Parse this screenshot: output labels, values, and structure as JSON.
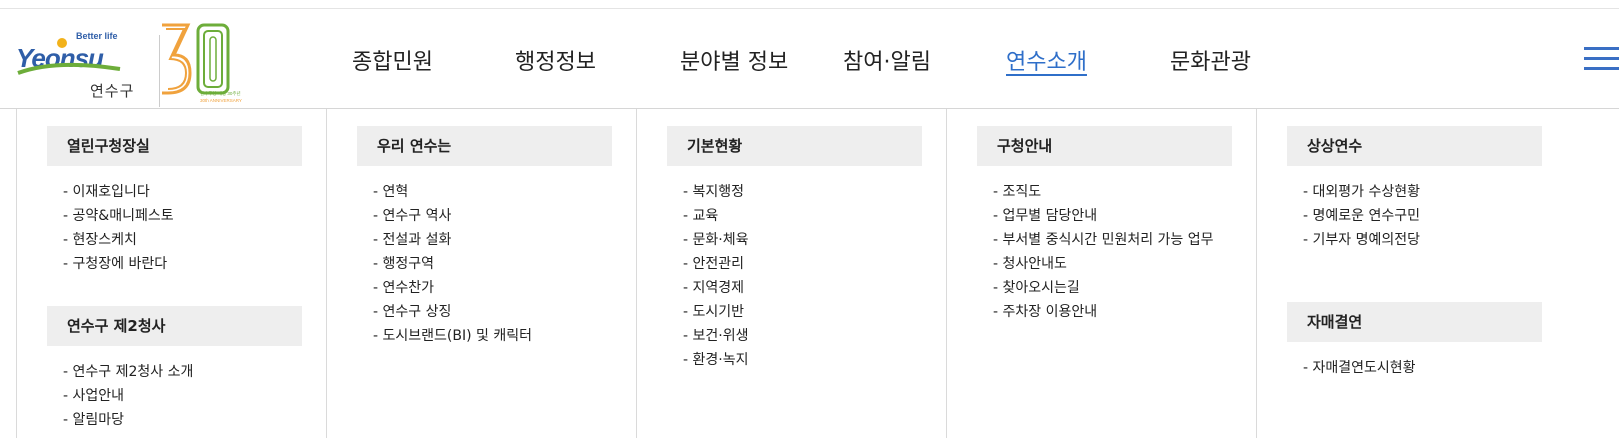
{
  "logo": {
    "tagline": "Better life",
    "wordmark": "Yeonsu",
    "district": "연수구",
    "anniversary_number": "30",
    "anniversary_small": "연수구청 개청 30주년",
    "anniversary_en": "30th ANNIVERSARY",
    "colors": {
      "green": "#6dad3a",
      "orange": "#f0a23d",
      "blue": "#2f5ea8",
      "gold": "#f2b21b"
    }
  },
  "nav": {
    "items": [
      {
        "label": "종합민원",
        "active": false
      },
      {
        "label": "행정정보",
        "active": false
      },
      {
        "label": "분야별 정보",
        "active": false
      },
      {
        "label": "참여·알림",
        "active": false
      },
      {
        "label": "연수소개",
        "active": true
      },
      {
        "label": "문화관광",
        "active": false
      }
    ],
    "menu_icon": "hamburger-menu-icon",
    "active_color": "#2f6fc9"
  },
  "mega_menu": {
    "columns": [
      {
        "sections": [
          {
            "title": "열린구청장실",
            "links": [
              "이재호입니다",
              "공약&매니페스토",
              "현장스케치",
              "구청장에 바란다"
            ]
          },
          {
            "title": "연수구 제2청사",
            "links": [
              "연수구 제2청사 소개",
              "사업안내",
              "알림마당"
            ]
          }
        ]
      },
      {
        "sections": [
          {
            "title": "우리 연수는",
            "links": [
              "연혁",
              "연수구 역사",
              "전설과 설화",
              "행정구역",
              "연수찬가",
              "연수구 상징",
              "도시브랜드(BI) 및 캐릭터"
            ]
          }
        ]
      },
      {
        "sections": [
          {
            "title": "기본현황",
            "links": [
              "복지행정",
              "교육",
              "문화·체육",
              "안전관리",
              "지역경제",
              "도시기반",
              "보건·위생",
              "환경·녹지"
            ]
          }
        ]
      },
      {
        "sections": [
          {
            "title": "구청안내",
            "links": [
              "조직도",
              "업무별 담당안내",
              "부서별 중식시간 민원처리 가능 업무",
              "청사안내도",
              "찾아오시는길",
              "주차장 이용안내"
            ]
          }
        ]
      },
      {
        "sections": [
          {
            "title": "상상연수",
            "links": [
              "대외평가 수상현황",
              "명예로운 연수구민",
              "기부자 명예의전당"
            ]
          },
          {
            "title": "자매결연",
            "links": [
              "자매결연도시현황"
            ]
          }
        ]
      }
    ]
  }
}
